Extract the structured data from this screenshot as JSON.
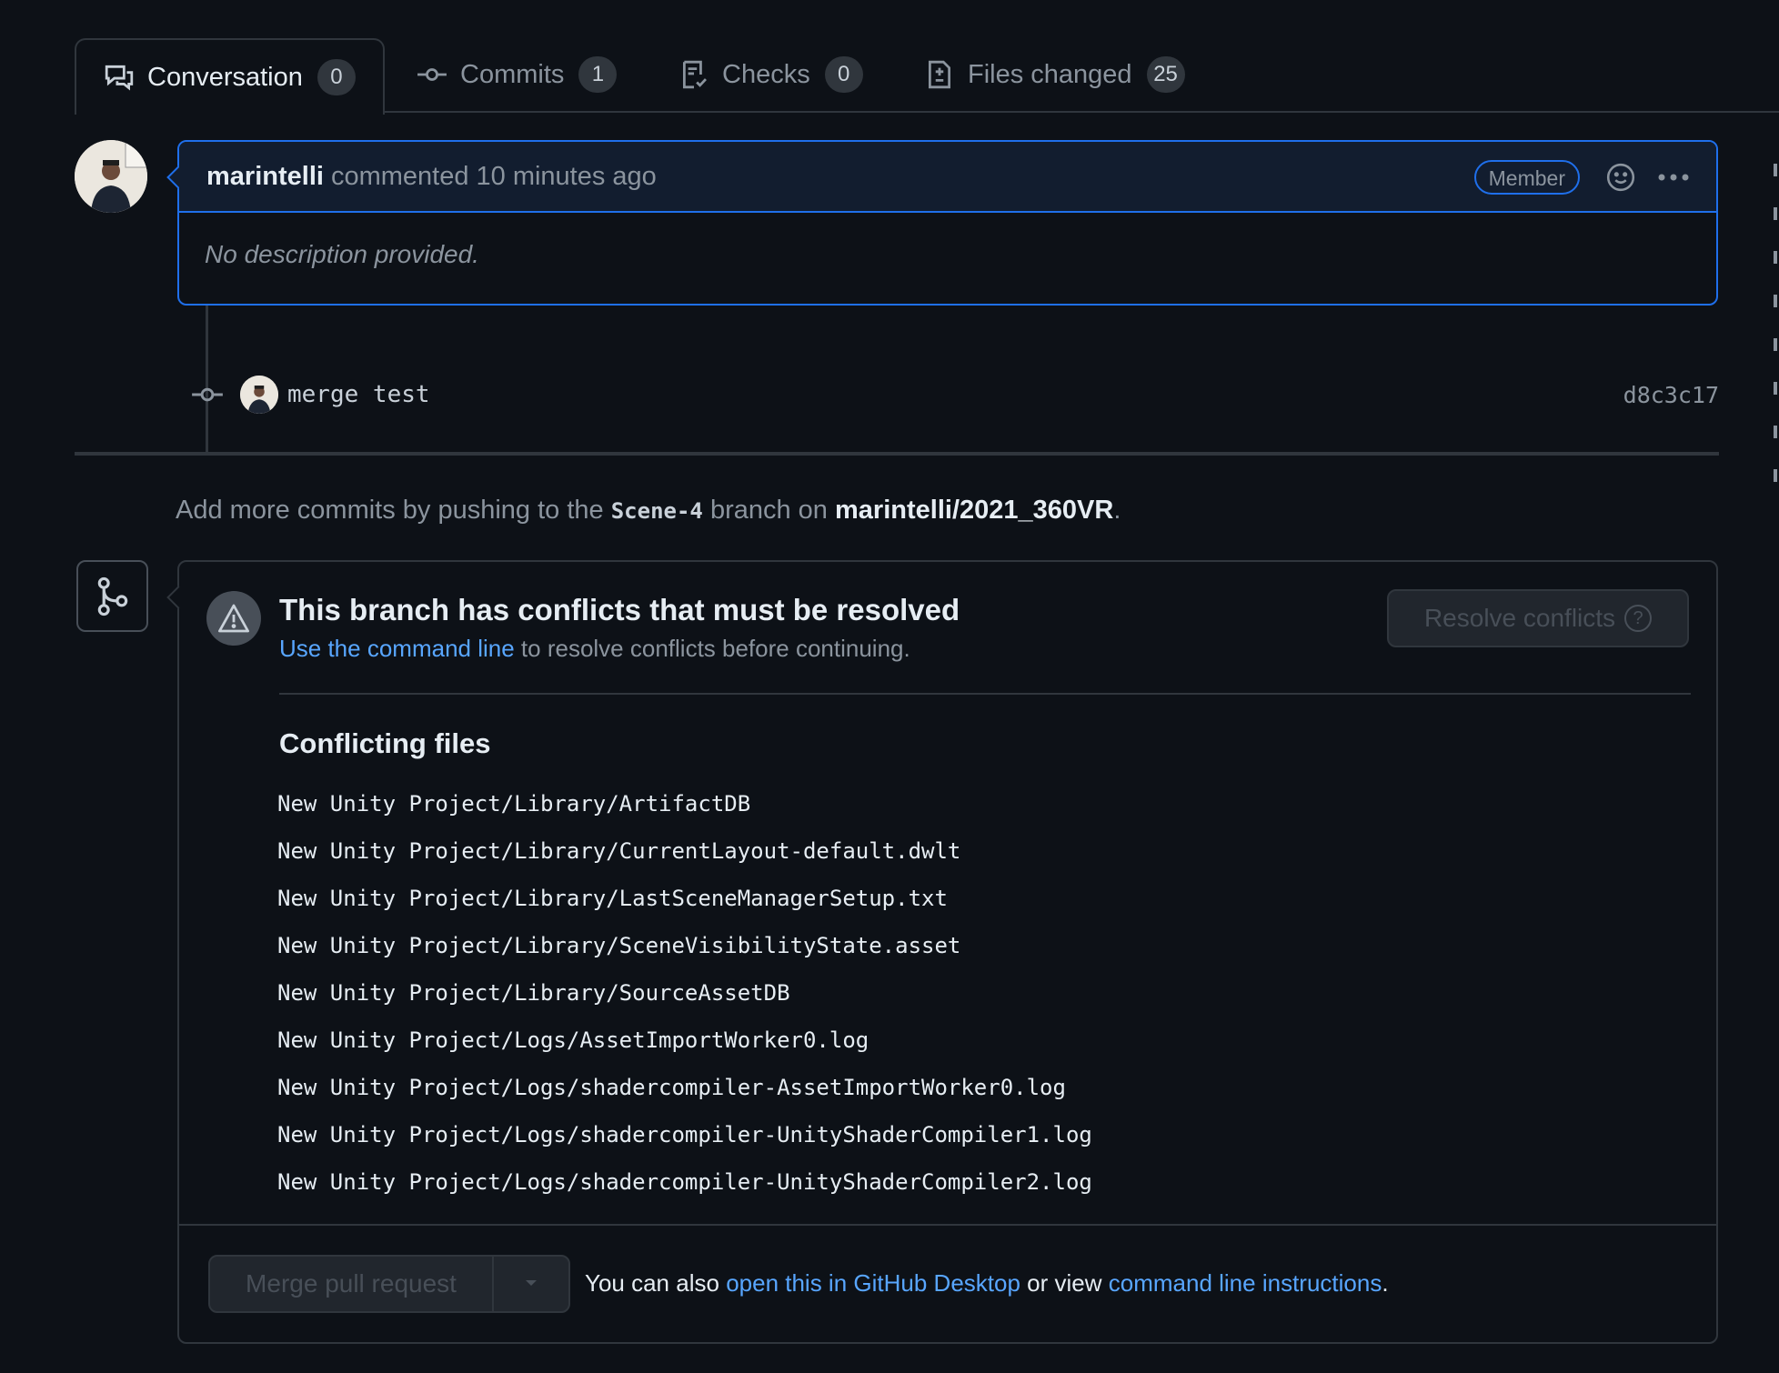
{
  "tabs": [
    {
      "label": "Conversation",
      "count": "0",
      "icon": "comment-discussion-icon"
    },
    {
      "label": "Commits",
      "count": "1",
      "icon": "git-commit-icon"
    },
    {
      "label": "Checks",
      "count": "0",
      "icon": "checklist-icon"
    },
    {
      "label": "Files changed",
      "count": "25",
      "icon": "file-diff-icon"
    }
  ],
  "comment": {
    "author": "marintelli",
    "action": "commented 10 minutes ago",
    "badge": "Member",
    "body": "No description provided."
  },
  "commit": {
    "message": "merge test",
    "sha": "d8c3c17"
  },
  "push_note": {
    "prefix": "Add more commits by pushing to the",
    "branch": "Scene-4",
    "middle": "branch on",
    "repo": "marintelli/2021_360VR",
    "suffix": "."
  },
  "merge": {
    "title": "This branch has conflicts that must be resolved",
    "link_text": "Use the command line",
    "sub_text": "to resolve conflicts before continuing.",
    "resolve_button": "Resolve conflicts",
    "conflicting_title": "Conflicting files",
    "files": [
      "New Unity Project/Library/ArtifactDB",
      "New Unity Project/Library/CurrentLayout-default.dwlt",
      "New Unity Project/Library/LastSceneManagerSetup.txt",
      "New Unity Project/Library/SceneVisibilityState.asset",
      "New Unity Project/Library/SourceAssetDB",
      "New Unity Project/Logs/AssetImportWorker0.log",
      "New Unity Project/Logs/shadercompiler-AssetImportWorker0.log",
      "New Unity Project/Logs/shadercompiler-UnityShaderCompiler1.log",
      "New Unity Project/Logs/shadercompiler-UnityShaderCompiler2.log"
    ],
    "merge_button": "Merge pull request",
    "footer_prefix": "You can also",
    "footer_link1": "open this in GitHub Desktop",
    "footer_middle": "or view",
    "footer_link2": "command line instructions",
    "footer_suffix": "."
  },
  "colors": {
    "background": "#0d1117",
    "accent_link": "#58a6ff",
    "comment_border": "#1f6feb",
    "border": "#30363d"
  }
}
